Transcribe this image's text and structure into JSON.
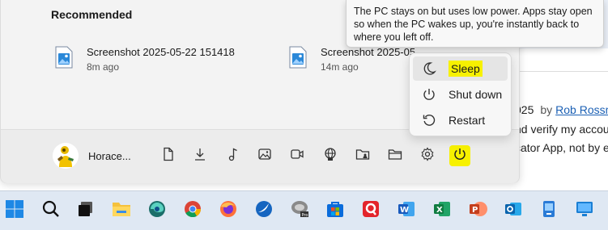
{
  "background_page": {
    "line1_date": "025",
    "line1_by": "by",
    "line1_author": "Rob Rossm",
    "line2": "nd verify my accou",
    "line3": "cator App, not by e"
  },
  "start_menu": {
    "recommended_title": "Recommended",
    "recommended_items": [
      {
        "name": "Screenshot 2025-05-22 151418",
        "time": "8m ago",
        "icon": "image-file-icon"
      },
      {
        "name": "Screenshot 2025-05-",
        "time": "14m ago",
        "icon": "image-file-icon"
      }
    ],
    "user": {
      "name": "Horace..."
    },
    "footer_icons": [
      "documents-icon",
      "downloads-icon",
      "music-icon",
      "pictures-icon",
      "videos-icon",
      "network-icon",
      "personal-folder-icon",
      "file-explorer-icon",
      "settings-icon",
      "power-icon"
    ]
  },
  "power_flyout": {
    "items": [
      {
        "label": "Sleep",
        "icon": "sleep-icon",
        "highlighted": true
      },
      {
        "label": "Shut down",
        "icon": "shutdown-icon"
      },
      {
        "label": "Restart",
        "icon": "restart-icon"
      }
    ]
  },
  "tooltip": {
    "text": "The PC stays on but uses low power. Apps stay open so when the PC wakes up, you're instantly back to where you left off."
  },
  "taskbar": {
    "icons": [
      "start-icon",
      "search-icon",
      "task-view-icon",
      "file-explorer-icon",
      "edge-dev-icon",
      "chrome-icon",
      "firefox-icon",
      "app-icon",
      "pro-app-icon",
      "store-icon",
      "app-icon",
      "word-icon",
      "excel-icon",
      "powerpoint-icon",
      "outlook-icon",
      "app-icon",
      "remote-desktop-icon"
    ]
  },
  "colors": {
    "highlight": "#f7f100",
    "taskbar_bg": "#dfe8f3",
    "menu_bg": "#f3f3f3",
    "link": "#1a5fb4"
  }
}
